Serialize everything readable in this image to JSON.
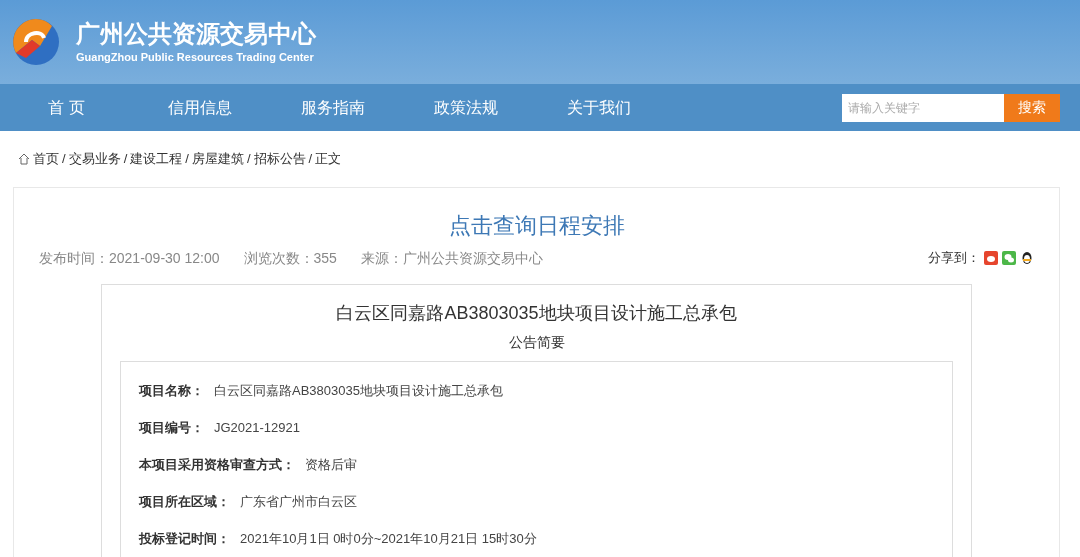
{
  "header": {
    "title": "广州公共资源交易中心",
    "subtitle": "GuangZhou Public Resources Trading Center"
  },
  "nav": {
    "items": [
      "首 页",
      "信用信息",
      "服务指南",
      "政策法规",
      "关于我们"
    ],
    "search": {
      "placeholder": "请输入关键字",
      "button": "搜索"
    }
  },
  "breadcrumb": {
    "separator": "/",
    "items": [
      "首页",
      "交易业务",
      "建设工程",
      "房屋建筑",
      "招标公告",
      "正文"
    ]
  },
  "article": {
    "title": "点击查询日程安排",
    "meta": [
      "发布时间：2021-09-30 12:00",
      "浏览次数：355",
      "来源：广州公共资源交易中心"
    ],
    "share_label": "分享到：",
    "notice": {
      "title": "白云区同嘉路AB3803035地块项目设计施工总承包",
      "subtitle": "公告简要",
      "fields": [
        {
          "label": "项目名称：",
          "value": "白云区同嘉路AB3803035地块项目设计施工总承包"
        },
        {
          "label": "项目编号：",
          "value": "JG2021-12921"
        },
        {
          "label": "本项目采用资格审查方式：",
          "value": "资格后审"
        },
        {
          "label": "项目所在区域：",
          "value": "广东省广州市白云区"
        },
        {
          "label": "投标登记时间：",
          "value": "2021年10月1日 0时0分~2021年10月21日 15时30分"
        }
      ]
    }
  }
}
